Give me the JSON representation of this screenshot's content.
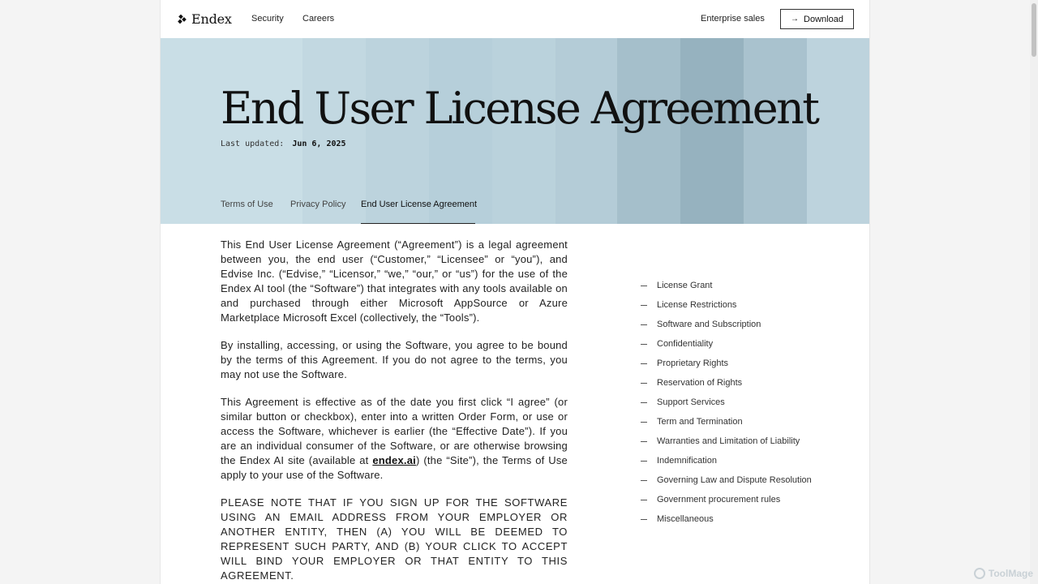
{
  "header": {
    "logo_text": "Endex",
    "nav": {
      "security": "Security",
      "careers": "Careers"
    },
    "enterprise_sales": "Enterprise sales",
    "download_label": "Download"
  },
  "hero": {
    "title": "End User License Agreement",
    "updated_label": "Last updated:",
    "updated_date": "Jun 6, 2025",
    "tabs": [
      {
        "label": "Terms of Use"
      },
      {
        "label": "Privacy Policy"
      },
      {
        "label": "End User License Agreement",
        "active": true
      }
    ]
  },
  "content": {
    "p1": "This End User License Agreement (“Agreement”) is a legal agreement between you, the end user (“Customer,” “Licensee” or “you”), and Edvise Inc. (“Edvise,” “Licensor,” “we,” “our,” or “us”) for the use of the Endex AI tool (the “Software”) that integrates with any tools available on and purchased through either Microsoft AppSource or Azure Marketplace Microsoft Excel (collectively, the “Tools”).",
    "p2": "By installing, accessing, or using the Software, you agree to be bound by the terms of this Agreement. If you do not agree to the terms, you may not use the Software.",
    "p3_before": "This Agreement is effective as of the date you first click “I agree” (or similar button or checkbox), enter into a written Order Form, or use or access the Software, whichever is earlier (the “Effective Date”). If you are an individual consumer of the Software, or are otherwise browsing the Endex AI site (available at ",
    "p3_link": "endex.ai",
    "p3_after": ") (the “Site”), the Terms of Use apply to your use of the Software.",
    "p4": "Please note that if you sign up for the software using an email address from your employer or another entity, then (A) you will be deemed to represent such party, and (B) your click to accept will bind your employer or that entity to this agreement."
  },
  "toc": {
    "items": [
      "License Grant",
      "License Restrictions",
      "Software and Subscription",
      "Confidentiality",
      "Proprietary Rights",
      "Reservation of Rights",
      "Support Services",
      "Term and Termination",
      "Warranties and Limitation of Liability",
      "Indemnification",
      "Governing Law and Dispute Resolution",
      "Government procurement rules",
      "Miscellaneous"
    ]
  },
  "watermark": "ToolMage"
}
